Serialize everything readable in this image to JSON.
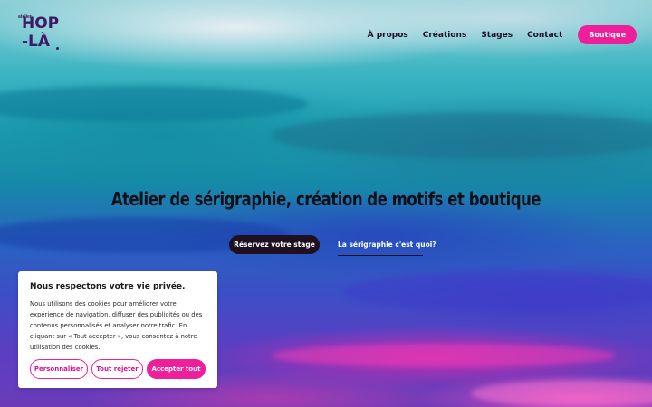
{
  "brand": {
    "small_label": "atelier",
    "line1": "HOP",
    "line2": "-LÀ"
  },
  "nav": {
    "items": [
      "À propos",
      "Créations",
      "Stages",
      "Contact"
    ],
    "shop_label": "Boutique"
  },
  "hero": {
    "headline": "Atelier de sérigraphie, création de motifs et boutique",
    "primary_cta": "Réservez votre stage",
    "secondary_link": "La sérigraphie c'est quoi?"
  },
  "cookie": {
    "title": "Nous respectons votre vie privée.",
    "body": "Nous utilisons des cookies pour améliorer votre expérience de navigation, diffuser des publicités ou des contenus personnalisés et analyser notre trafic. En cliquant sur « Tout accepter », vous consentez à notre utilisation des cookies.",
    "customize": "Personnaliser",
    "reject": "Tout rejeter",
    "accept": "Accepter tout"
  },
  "colors": {
    "accent": "#ef1f9b",
    "dark": "#1e1020",
    "logo": "#3d1a66"
  }
}
